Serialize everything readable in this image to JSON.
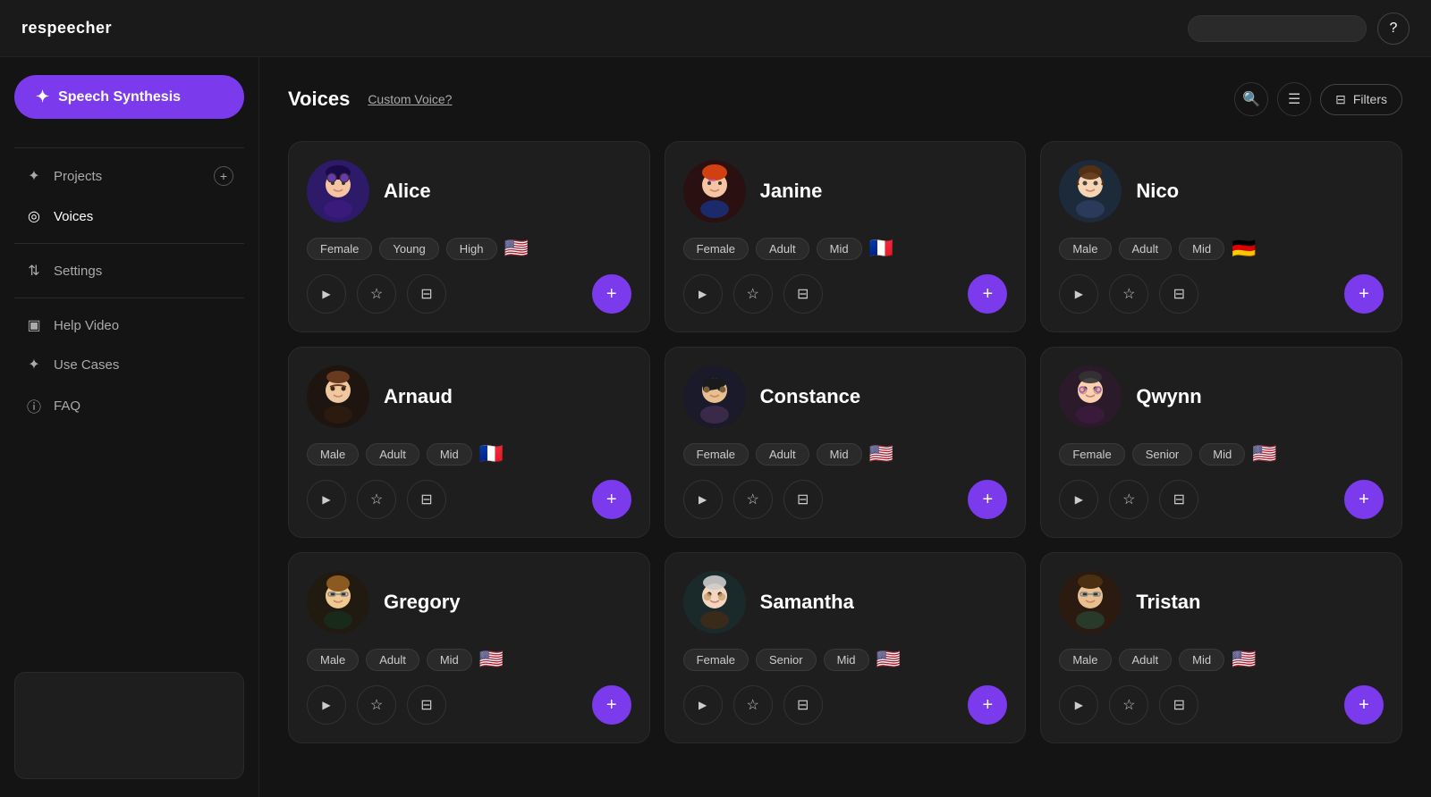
{
  "app": {
    "logo": "respeecher",
    "search_placeholder": ""
  },
  "topbar": {
    "help_label": "?"
  },
  "sidebar": {
    "speech_synthesis_label": "Speech Synthesis",
    "items": [
      {
        "id": "projects",
        "label": "Projects",
        "icon": "✦",
        "has_add": true
      },
      {
        "id": "voices",
        "label": "Voices",
        "icon": "◎",
        "active": true
      },
      {
        "id": "settings",
        "label": "Settings",
        "icon": "⇅"
      },
      {
        "id": "help-video",
        "label": "Help Video",
        "icon": "▣"
      },
      {
        "id": "use-cases",
        "label": "Use Cases",
        "icon": "✦"
      },
      {
        "id": "faq",
        "label": "FAQ",
        "icon": "ⓘ"
      }
    ]
  },
  "content": {
    "title": "Voices",
    "custom_voice_link": "Custom Voice?",
    "filters_label": "Filters",
    "voices": [
      {
        "id": "alice",
        "name": "Alice",
        "tags": [
          "Female",
          "Young",
          "High"
        ],
        "flag": "🇺🇸",
        "avatar_emoji": "👩",
        "avatar_class": "avatar-alice"
      },
      {
        "id": "janine",
        "name": "Janine",
        "tags": [
          "Female",
          "Adult",
          "Mid"
        ],
        "flag": "🇫🇷",
        "avatar_emoji": "👩",
        "avatar_class": "avatar-janine"
      },
      {
        "id": "nico",
        "name": "Nico",
        "tags": [
          "Male",
          "Adult",
          "Mid"
        ],
        "flag": "🇩🇪",
        "avatar_emoji": "👨",
        "avatar_class": "avatar-nico"
      },
      {
        "id": "arnaud",
        "name": "Arnaud",
        "tags": [
          "Male",
          "Adult",
          "Mid"
        ],
        "flag": "🇫🇷",
        "avatar_emoji": "👨",
        "avatar_class": "avatar-arnaud"
      },
      {
        "id": "constance",
        "name": "Constance",
        "tags": [
          "Female",
          "Adult",
          "Mid"
        ],
        "flag": "🇺🇸",
        "avatar_emoji": "👩",
        "avatar_class": "avatar-constance"
      },
      {
        "id": "qwynn",
        "name": "Qwynn",
        "tags": [
          "Female",
          "Senior",
          "Mid"
        ],
        "flag": "🇺🇸",
        "avatar_emoji": "👩",
        "avatar_class": "avatar-qwynn"
      },
      {
        "id": "gregory",
        "name": "Gregory",
        "tags": [
          "Male",
          "Adult",
          "Mid"
        ],
        "flag": "🇺🇸",
        "avatar_emoji": "👨",
        "avatar_class": "avatar-gregory"
      },
      {
        "id": "samantha",
        "name": "Samantha",
        "tags": [
          "Female",
          "Senior",
          "Mid"
        ],
        "flag": "🇺🇸",
        "avatar_emoji": "👩",
        "avatar_class": "avatar-samantha"
      },
      {
        "id": "tristan",
        "name": "Tristan",
        "tags": [
          "Male",
          "Adult",
          "Mid"
        ],
        "flag": "🇺🇸",
        "avatar_emoji": "👨",
        "avatar_class": "avatar-tristan"
      }
    ]
  }
}
